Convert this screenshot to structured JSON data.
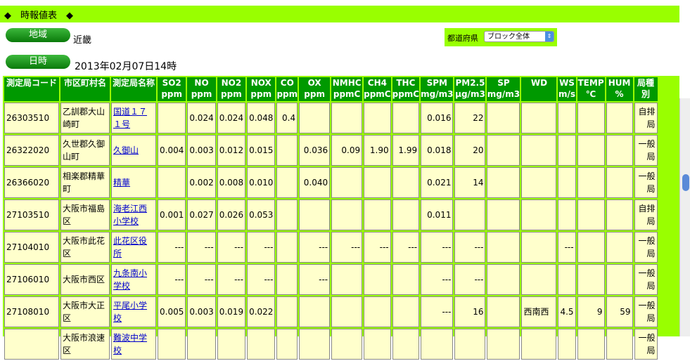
{
  "title": "◆　時報値表　◆",
  "region_btn": "地域",
  "region_value": "近畿",
  "datetime_btn": "日時",
  "datetime_value": "2013年02月07日14時",
  "pref_label": "都道府県",
  "pref_select": "ブロック全体",
  "headers": [
    "測定局コード",
    "市区町村名",
    "測定局名称",
    "SO2",
    "NO",
    "NO2",
    "NOX",
    "CO",
    "OX",
    "NMHC",
    "CH4",
    "THC",
    "SPM",
    "PM2.5",
    "SP",
    "WD",
    "WS",
    "TEMP",
    "HUM",
    "局種別"
  ],
  "header_units": [
    "",
    "",
    "",
    "ppm",
    "ppm",
    "ppm",
    "ppm",
    "ppm",
    "ppm",
    "ppmC",
    "ppmC",
    "ppmC",
    "mg/m3",
    "μg/m3",
    "mg/m3",
    "",
    "m/s",
    "℃",
    "%",
    ""
  ],
  "rows": [
    [
      "26303510",
      "乙訓郡大山崎町",
      "国道１７１号",
      "",
      "0.024",
      "0.024",
      "0.048",
      "0.4",
      "",
      "",
      "",
      "",
      "0.016",
      "22",
      "",
      "",
      "",
      "",
      "",
      "自排局"
    ],
    [
      "26322020",
      "久世郡久御山町",
      "久御山",
      "0.004",
      "0.003",
      "0.012",
      "0.015",
      "",
      "0.036",
      "0.09",
      "1.90",
      "1.99",
      "0.018",
      "20",
      "",
      "",
      "",
      "",
      "",
      "一般局"
    ],
    [
      "26366020",
      "相楽郡精華町",
      "精華",
      "",
      "0.002",
      "0.008",
      "0.010",
      "",
      "0.040",
      "",
      "",
      "",
      "0.021",
      "14",
      "",
      "",
      "",
      "",
      "",
      "一般局"
    ],
    [
      "27103510",
      "大阪市福島区",
      "海老江西小学校",
      "0.001",
      "0.027",
      "0.026",
      "0.053",
      "",
      "",
      "",
      "",
      "",
      "0.011",
      "",
      "",
      "",
      "",
      "",
      "",
      "自排局"
    ],
    [
      "27104010",
      "大阪市此花区",
      "此花区役所",
      "---",
      "---",
      "---",
      "---",
      "",
      "---",
      "---",
      "---",
      "---",
      "---",
      "---",
      "",
      "",
      "---",
      "",
      "",
      "一般局"
    ],
    [
      "27106010",
      "大阪市西区",
      "九条南小学校",
      "---",
      "---",
      "---",
      "---",
      "",
      "---",
      "",
      "",
      "",
      "---",
      "---",
      "",
      "",
      "",
      "",
      "",
      "一般局"
    ],
    [
      "27108010",
      "大阪市大正区",
      "平尾小学校",
      "0.005",
      "0.003",
      "0.019",
      "0.022",
      "",
      "",
      "",
      "",
      "",
      "---",
      "16",
      "",
      "西南西",
      "4.5",
      "9",
      "59",
      "一般局"
    ],
    [
      "",
      "大阪市浪速区",
      "難波中学校",
      "",
      "",
      "",
      "",
      "",
      "",
      "",
      "",
      "",
      "",
      "",
      "",
      "",
      "",
      "",
      "",
      "一般局"
    ]
  ]
}
